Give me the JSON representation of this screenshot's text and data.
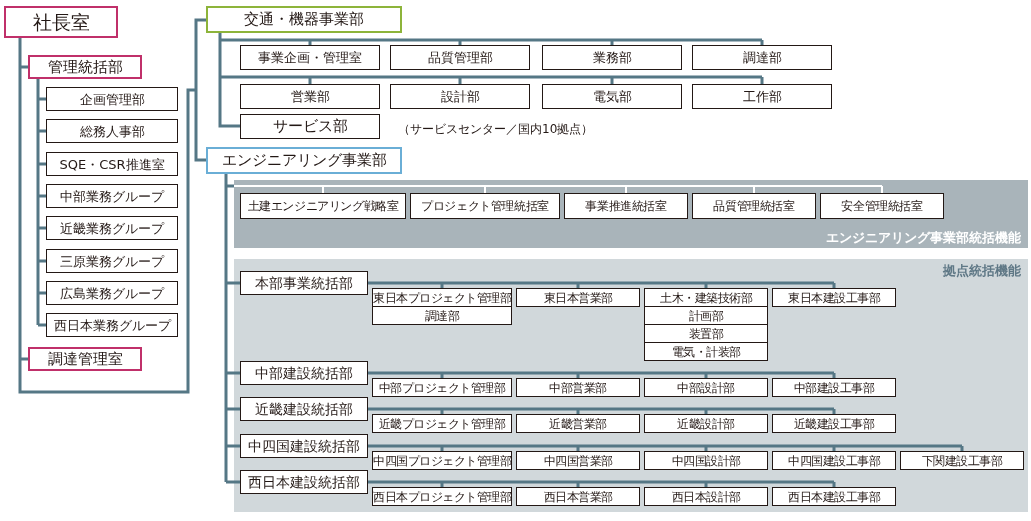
{
  "president": {
    "label": "社長室"
  },
  "admin": {
    "label": "管理統括部",
    "children": [
      "企画管理部",
      "総務人事部",
      "SQE・CSR推進室",
      "中部業務グループ",
      "近畿業務グループ",
      "三原業務グループ",
      "広島業務グループ",
      "西日本業務グループ"
    ]
  },
  "procurement": {
    "label": "調達管理室"
  },
  "transport": {
    "label": "交通・機器事業部",
    "rows": [
      [
        "事業企画・管理室",
        "品質管理部",
        "業務部",
        "調達部"
      ],
      [
        "営業部",
        "設計部",
        "電気部",
        "工作部"
      ]
    ],
    "service": {
      "label": "サービス部",
      "note": "（サービスセンター／国内10拠点）"
    }
  },
  "engineering": {
    "label": "エンジニアリング事業部",
    "staff": {
      "caption": "エンジニアリング事業部統括機能",
      "offices": [
        "土建エンジニアリング戦略室",
        "プロジェクト管理統括室",
        "事業推進統括室",
        "品質管理統括室",
        "安全管理統括室"
      ]
    },
    "regional": {
      "caption": "拠点統括機能",
      "divisions": [
        {
          "label": "本部事業統括部",
          "departments": [
            [
              "東日本プロジェクト管理部",
              "調達部"
            ],
            [
              "東日本営業部"
            ],
            [
              "土木・建築技術部",
              "計画部",
              "装置部",
              "電気・計装部"
            ],
            [
              "東日本建設工事部"
            ]
          ]
        },
        {
          "label": "中部建設統括部",
          "departments": [
            [
              "中部プロジェクト管理部"
            ],
            [
              "中部営業部"
            ],
            [
              "中部設計部"
            ],
            [
              "中部建設工事部"
            ]
          ]
        },
        {
          "label": "近畿建設統括部",
          "departments": [
            [
              "近畿プロジェクト管理部"
            ],
            [
              "近畿営業部"
            ],
            [
              "近畿設計部"
            ],
            [
              "近畿建設工事部"
            ]
          ]
        },
        {
          "label": "中四国建設統括部",
          "departments": [
            [
              "中四国プロジェクト管理部"
            ],
            [
              "中四国営業部"
            ],
            [
              "中四国設計部"
            ],
            [
              "中四国建設工事部"
            ],
            [
              "下関建設工事部"
            ]
          ]
        },
        {
          "label": "西日本建設統括部",
          "departments": [
            [
              "西日本プロジェクト管理部"
            ],
            [
              "西日本営業部"
            ],
            [
              "西日本設計部"
            ],
            [
              "西日本建設工事部"
            ]
          ]
        }
      ]
    }
  }
}
